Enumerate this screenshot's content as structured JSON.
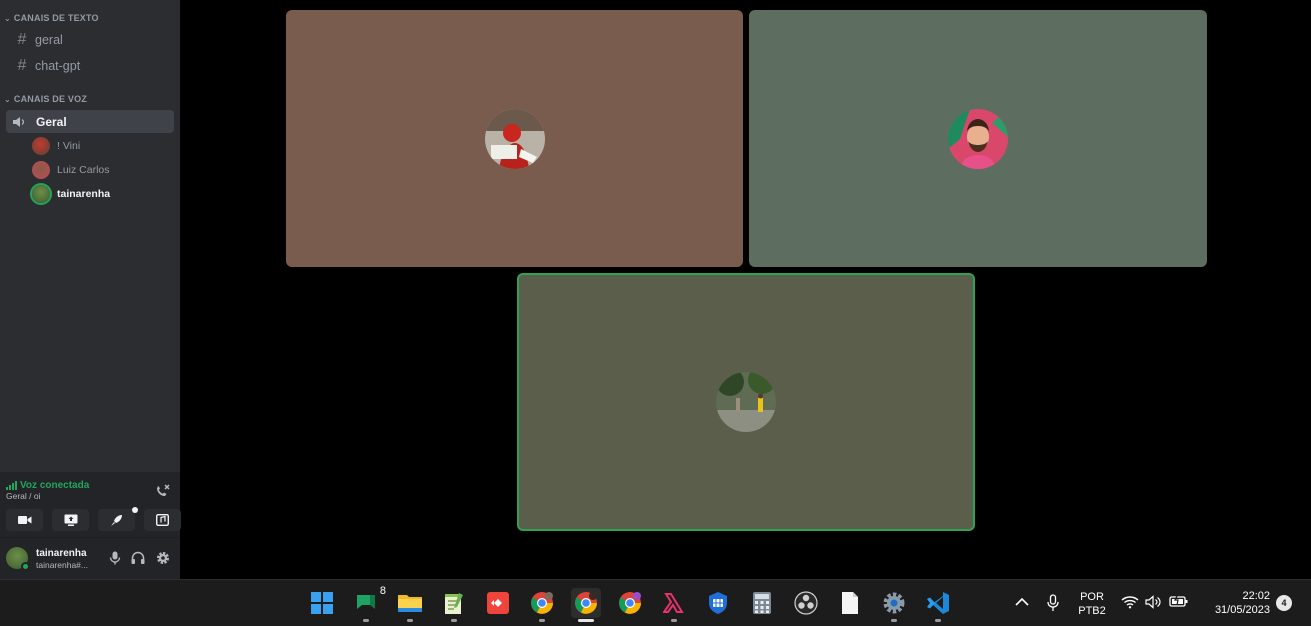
{
  "sidebar": {
    "text_category": "CANAIS DE TEXTO",
    "text_channels": [
      {
        "label": "geral"
      },
      {
        "label": "chat-gpt"
      }
    ],
    "voice_category": "CANAIS DE VOZ",
    "voice_channel": "Geral",
    "members": [
      {
        "name": "! Vini"
      },
      {
        "name": "Luiz Carlos"
      },
      {
        "name": "tainarenha"
      }
    ]
  },
  "voice_panel": {
    "status": "Voz conectada",
    "location": "Geral / oi"
  },
  "user_panel": {
    "username": "tainarenha",
    "tag": "tainarenha#..."
  },
  "stage": {
    "tiles": [
      {
        "participant": "! Vini",
        "background": "#7a5c4f"
      },
      {
        "participant": "Luiz Carlos",
        "background": "#5d6e61"
      },
      {
        "participant": "tainarenha",
        "background": "#5b5e4b",
        "speaking": true
      }
    ]
  },
  "taskbar": {
    "apps": [
      {
        "icon": "windows-start-icon"
      },
      {
        "icon": "google-chat-icon",
        "badge": "8"
      },
      {
        "icon": "file-explorer-icon"
      },
      {
        "icon": "notepad-plus-plus-icon"
      },
      {
        "icon": "anydesk-icon"
      },
      {
        "icon": "chrome-profile-1-icon"
      },
      {
        "icon": "chrome-profile-2-icon"
      },
      {
        "icon": "chrome-profile-3-icon"
      },
      {
        "icon": "lambda-app-icon"
      },
      {
        "icon": "defender-icon"
      },
      {
        "icon": "calculator-icon"
      },
      {
        "icon": "obs-studio-icon"
      },
      {
        "icon": "blank-document-icon"
      },
      {
        "icon": "settings-gear-icon"
      },
      {
        "icon": "vscode-icon"
      }
    ],
    "language": "POR",
    "layout": "PTB2",
    "time": "22:02",
    "date": "31/05/2023",
    "notifications": "4"
  },
  "colors": {
    "voice_connected": "#23a55a",
    "speaking_border": "#2fa352",
    "sidebar_bg": "#2b2d31"
  }
}
